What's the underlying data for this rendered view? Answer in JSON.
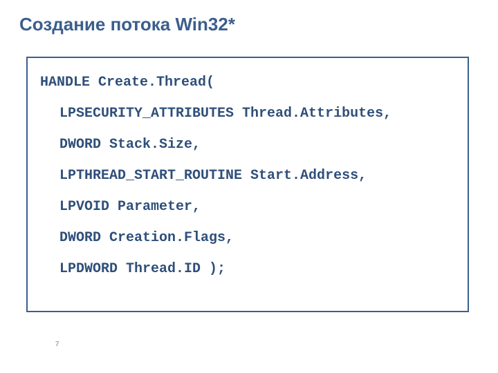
{
  "title": "Создание потока Win32*",
  "code": {
    "l0": "HANDLE Create.Thread(",
    "l1": "LPSECURITY_ATTRIBUTES Thread.Attributes,",
    "l2": "DWORD Stack.Size,",
    "l3": "LPTHREAD_START_ROUTINE Start.Address,",
    "l4": "LPVOID Parameter,",
    "l5": "DWORD Creation.Flags,",
    "l6": "LPDWORD Thread.ID );"
  },
  "pagenum": "7"
}
